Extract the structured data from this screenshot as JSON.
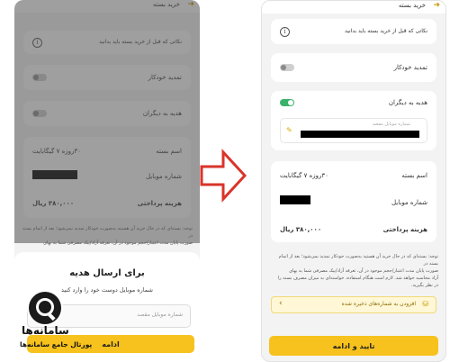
{
  "header": {
    "title": "خرید بسته"
  },
  "notice_row": {
    "label": "نکاتی که قبل از خرید بسته باید بدانید"
  },
  "auto_renew": {
    "label": "تمدید خودکار"
  },
  "gift": {
    "label": "هدیه به دیگران",
    "field_label": "شماره موبایل مقصد"
  },
  "summary": {
    "package_label": "اسم بسته",
    "package_value": "۳۰روزه ۷ گیگابایت",
    "mobile_label": "شماره موبایل",
    "cost_label": "هزینه پرداختی",
    "cost_value": "۳۸۰,۰۰۰ ریال"
  },
  "notice_text": {
    "lines": [
      "توجه: بسته‌ای که در حال خرید آن هستید به‌صورت خودکار تمدید نمی‌شود؛ بعد از اتمام بسته در",
      "صورت پایان مدت اعتبار/حجم موجود در آن، تعرفه آزاد/پیک مصرفی شما به بهای",
      "آزاد محاسبه خواهد شد. لازم است هنگام استفاده، خواسته‌ای به میزان مصرف بسته را",
      "در نظر بگیرید."
    ]
  },
  "save_numbers": {
    "label": "افزودن به شماره‌های ذخیره شده"
  },
  "confirm": {
    "label": "تایید و ادامه"
  },
  "sheet": {
    "title": "برای ارسال هدیه",
    "subtitle": "شماره موبایل دوست خود را وارد کنید",
    "input_placeholder": "شماره موبایل مقصد",
    "continue_label": "ادامه"
  },
  "watermark": {
    "name": "سامانه‌ها",
    "tagline": "پورتال جامع سامانه‌ها"
  },
  "colors": {
    "accent": "#f7c21d",
    "toggle_on": "#3ab36a",
    "arrow": "#d9342b"
  },
  "icons": [
    "back-arrow-icon",
    "info-icon",
    "pencil-icon",
    "database-icon",
    "chevron-left-icon"
  ]
}
